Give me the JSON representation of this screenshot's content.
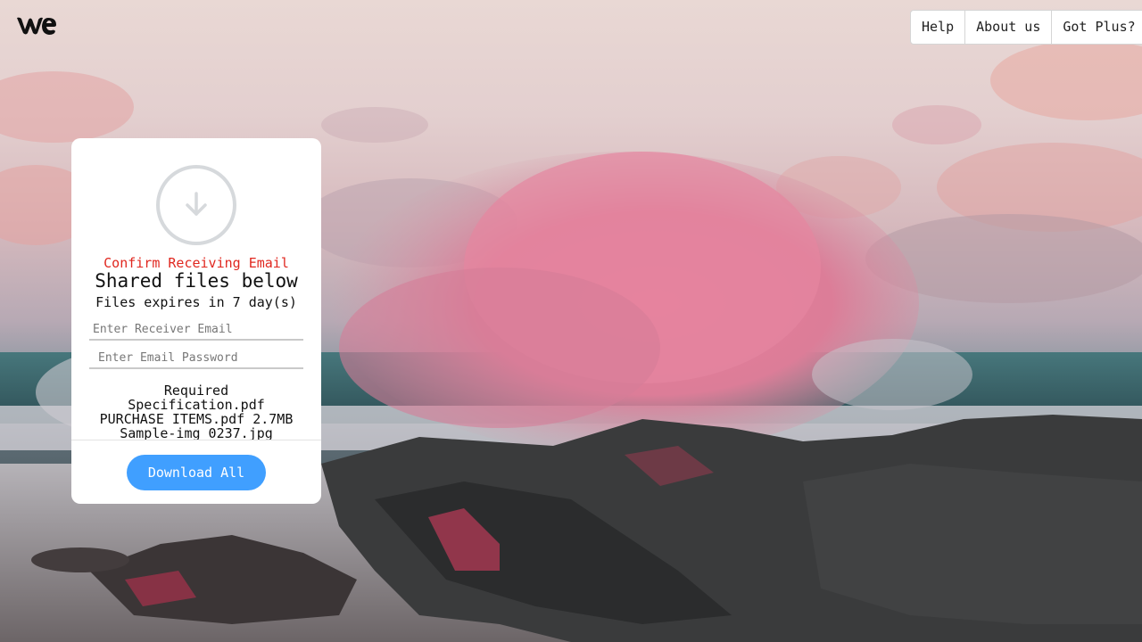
{
  "header": {
    "logo_text": "we",
    "nav": [
      {
        "label": "Help"
      },
      {
        "label": "About us"
      },
      {
        "label": "Got Plus?"
      }
    ]
  },
  "card": {
    "confirm_text": "Confirm Receiving Email",
    "title": "Shared files below",
    "expiry_text": "Files expires in 7 day(s)",
    "email_placeholder": "Enter Receiver Email",
    "password_placeholder": "Enter Email Password",
    "files": [
      {
        "text": "Required"
      },
      {
        "text": "Specification.pdf"
      },
      {
        "text": "PURCHASE ITEMS.pdf 2.7MB"
      },
      {
        "text": "Sample-img 0237.jpg"
      }
    ],
    "download_label": "Download All"
  },
  "icons": {
    "download": "download-arrow-icon",
    "logo": "wetransfer-logo-icon"
  },
  "colors": {
    "accent": "#409fff",
    "warning_text": "#e0271f",
    "card_bg": "#ffffff"
  }
}
